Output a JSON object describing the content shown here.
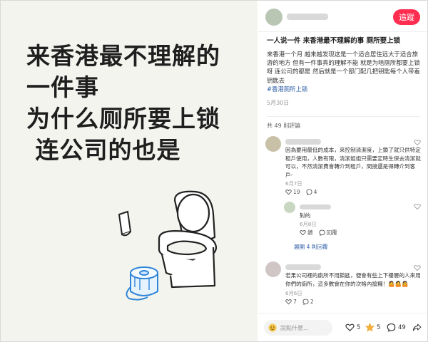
{
  "image": {
    "headline_lines": [
      {
        "parts": [
          "来",
          "香港",
          "最不理解的"
        ]
      },
      {
        "parts": [
          "一件事"
        ]
      },
      {
        "parts": [
          "为什么厕所要上锁"
        ]
      },
      {
        "parts": [
          " 连公司的也是"
        ]
      }
    ]
  },
  "author": {
    "follow_label": "追蹤"
  },
  "post": {
    "title": "一人说一件 来香港最不理解的事 厕所要上锁",
    "text": "来香港一个月 越来越发现这是一个适合居住远大于适合旅游的地方 但有一件事真的理解不能 就是为啥厕所都要上锁呀 连公司的都是 然后就是一个部门配几把钥匙每个人带着钥匙去",
    "tag": "#香港厕所上锁",
    "date": "5月30日",
    "comment_count": "共 49 則評論"
  },
  "comments": [
    {
      "text": "因為要用最低的成本，來控制清潔度，上鎖了就只供特定租戶使用，人數有限，清潔姐姐只需要定時生保去清潔就可以，不然清潔費會轉介到租戶，間接還是得轉介到客戶-",
      "date": "6月7日",
      "likes": "19",
      "replies": "4",
      "reply": {
        "text": "對的",
        "date": "6月8日",
        "action_like": "讚",
        "action_reply": "回覆"
      },
      "expand_label": "展開 4 則回覆"
    },
    {
      "text": "若果公司裡的廁所不用鎖匙，便會有些上下樓層的人來用你們的廁所，這多數會在你的次格內搶糧！🤷🤷🤷",
      "date": "6月6日",
      "likes": "7",
      "replies": "2"
    }
  ],
  "bottom_bar": {
    "input_placeholder": "說點什麼...",
    "likes": "5",
    "favorites": "5",
    "comments": "49"
  },
  "colors": {
    "accent": "#ff2d4f",
    "link": "#2f5fa6",
    "highlight": "#8ec8ff"
  }
}
